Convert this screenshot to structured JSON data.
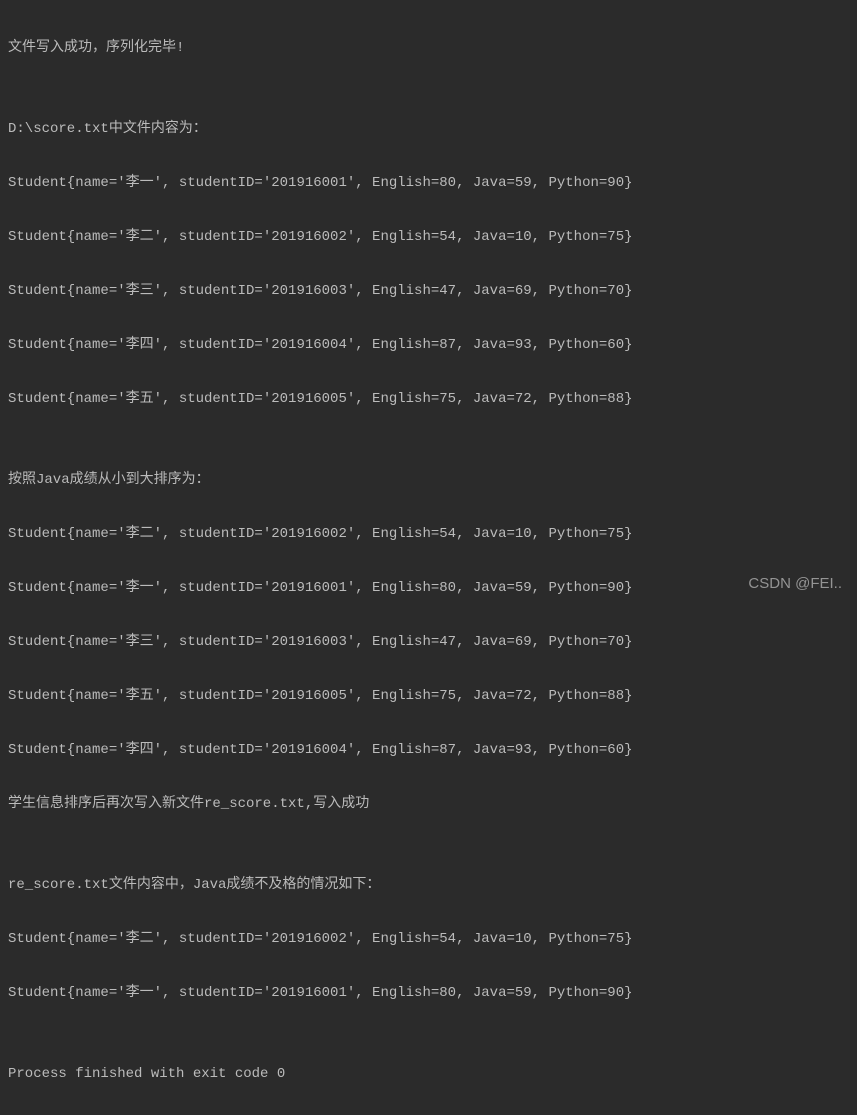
{
  "lines": {
    "l1": "文件写入成功，序列化完毕!",
    "l2": "",
    "l3": "D:\\score.txt中文件内容为：",
    "l4": "Student{name='李一', studentID='201916001', English=80, Java=59, Python=90}",
    "l5": "Student{name='李二', studentID='201916002', English=54, Java=10, Python=75}",
    "l6": "Student{name='李三', studentID='201916003', English=47, Java=69, Python=70}",
    "l7": "Student{name='李四', studentID='201916004', English=87, Java=93, Python=60}",
    "l8": "Student{name='李五', studentID='201916005', English=75, Java=72, Python=88}",
    "l9": "",
    "l10": "按照Java成绩从小到大排序为：",
    "l11": "Student{name='李二', studentID='201916002', English=54, Java=10, Python=75}",
    "l12": "Student{name='李一', studentID='201916001', English=80, Java=59, Python=90}",
    "l13": "Student{name='李三', studentID='201916003', English=47, Java=69, Python=70}",
    "l14": "Student{name='李五', studentID='201916005', English=75, Java=72, Python=88}",
    "l15": "Student{name='李四', studentID='201916004', English=87, Java=93, Python=60}",
    "l16": "学生信息排序后再次写入新文件re_score.txt,写入成功",
    "l17": "",
    "l18": "re_score.txt文件内容中，Java成绩不及格的情况如下：",
    "l19": "Student{name='李二', studentID='201916002', English=54, Java=10, Python=75}",
    "l20": "Student{name='李一', studentID='201916001', English=80, Java=59, Python=90}",
    "l21": "",
    "l22": "Process finished with exit code 0"
  },
  "watermark": "CSDN @FEI.."
}
